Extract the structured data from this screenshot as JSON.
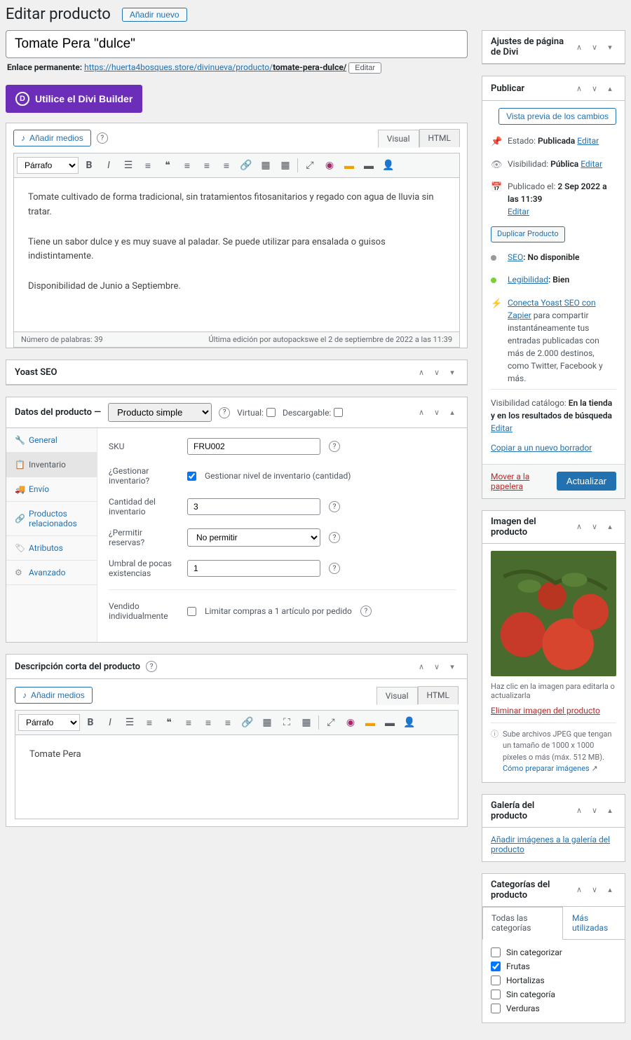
{
  "header": {
    "title": "Editar producto",
    "add_new": "Añadir nuevo"
  },
  "product_title": "Tomate Pera \"dulce\"",
  "permalink": {
    "label": "Enlace permanente:",
    "url_base": "https://huerta4bosques.store/divinueva/producto/",
    "slug": "tomate-pera-dulce/",
    "edit": "Editar"
  },
  "divi": {
    "label": "Utilice el Divi Builder",
    "letter": "D"
  },
  "editor": {
    "add_media": "Añadir medios",
    "tabs": {
      "visual": "Visual",
      "html": "HTML"
    },
    "format": "Párrafo",
    "body_p1": "Tomate cultivado de forma tradicional, sin tratamientos fitosanitarios y regado con agua de lluvia sin tratar.",
    "body_p2": "Tiene un sabor dulce y es muy suave al paladar. Se puede utilizar para ensalada o guisos indistintamente.",
    "body_p3": "Disponibilidad de Junio a Septiembre.",
    "word_count_label": "Número de palabras: ",
    "word_count": "39",
    "last_edit": "Última edición por autopackswe el 2 de septiembre de 2022 a las 11:39"
  },
  "yoast": {
    "title": "Yoast SEO"
  },
  "product_data": {
    "title": "Datos del producto —",
    "type": "Producto simple",
    "virtual": "Virtual:",
    "downloadable": "Descargable:",
    "tabs": {
      "general": "General",
      "inventory": "Inventario",
      "shipping": "Envío",
      "linked": "Productos relacionados",
      "attributes": "Atributos",
      "advanced": "Avanzado"
    },
    "fields": {
      "sku_label": "SKU",
      "sku_value": "FRU002",
      "manage_label": "¿Gestionar inventario?",
      "manage_text": "Gestionar nivel de inventario (cantidad)",
      "qty_label": "Cantidad del inventario",
      "qty_value": "3",
      "backorders_label": "¿Permitir reservas?",
      "backorders_value": "No permitir",
      "low_label": "Umbral de pocas existencias",
      "low_value": "1",
      "sold_ind_label": "Vendido individualmente",
      "sold_ind_text": "Limitar compras a 1 artículo por pedido"
    }
  },
  "short_desc": {
    "title": "Descripción corta del producto",
    "add_media": "Añadir medios",
    "format": "Párrafo",
    "body": "Tomate Pera"
  },
  "divi_box": {
    "title": "Ajustes de página de Divi"
  },
  "publish": {
    "title": "Publicar",
    "preview": "Vista previa de los cambios",
    "status_label": "Estado:",
    "status_value": "Publicada",
    "edit": "Editar",
    "visibility_label": "Visibilidad:",
    "visibility_value": "Pública",
    "published_label": "Publicado el:",
    "published_value": "2 Sep 2022 a las 11:39",
    "duplicate": "Duplicar Producto",
    "seo_label": "SEO",
    "seo_value": ": No disponible",
    "readability_label": "Legibilidad",
    "readability_value": ": Bien",
    "zapier_link": "Conecta Yoast SEO con Zapier",
    "zapier_text": " para compartir instantáneamente tus entradas publicadas con más de 2.000 destinos, como Twitter, Facebook y más.",
    "catalog_label": "Visibilidad catálogo:",
    "catalog_value": "En la tienda y en los resultados de búsqueda",
    "copy_draft": "Copiar a un nuevo borrador",
    "trash": "Mover a la papelera",
    "update": "Actualizar"
  },
  "product_image": {
    "title": "Imagen del producto",
    "hint": "Haz clic en la imagen para editarla o actualizarla",
    "remove": "Eliminar imagen del producto",
    "upload_hint": "Sube archivos JPEG que tengan un tamaño de 1000 x 1000 píxeles o más (máx. 512 MB). ",
    "upload_link": "Cómo preparar imágenes"
  },
  "gallery": {
    "title": "Galería del producto",
    "add": "Añadir imágenes a la galería del producto"
  },
  "categories": {
    "title": "Categorías del producto",
    "all": "Todas las categorías",
    "most": "Más utilizadas",
    "items": [
      {
        "name": "Sin categorizar",
        "checked": false
      },
      {
        "name": "Frutas",
        "checked": true
      },
      {
        "name": "Hortalizas",
        "checked": false
      },
      {
        "name": "Sin categoría",
        "checked": false
      },
      {
        "name": "Verduras",
        "checked": false
      }
    ]
  }
}
